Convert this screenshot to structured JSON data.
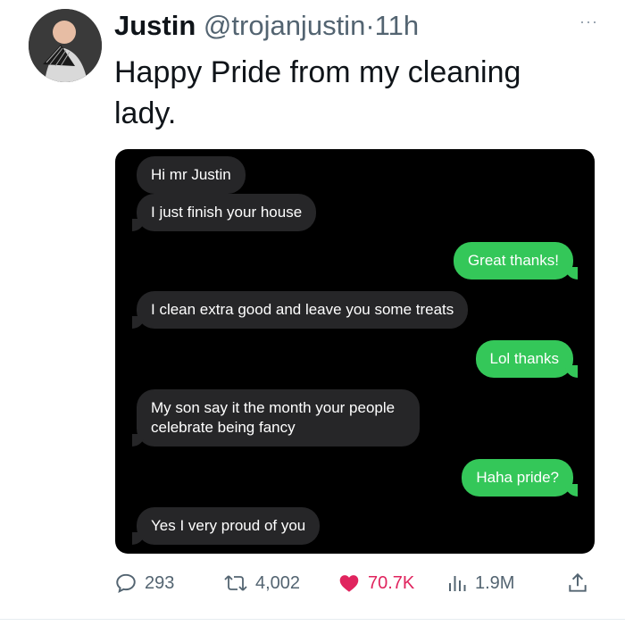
{
  "tweet": {
    "author_name": "Justin",
    "handle": "@trojanjustin",
    "separator": "·",
    "time": "11h",
    "more_label": "···",
    "text": "Happy Pride from my cleaning lady."
  },
  "messages": [
    {
      "side": "in",
      "text": "Hi mr Justin"
    },
    {
      "side": "in",
      "text": "I just finish your house"
    },
    {
      "side": "out",
      "text": "Great thanks!"
    },
    {
      "side": "in",
      "text": "I clean extra good and leave you some treats"
    },
    {
      "side": "out",
      "text": "Lol thanks"
    },
    {
      "side": "in",
      "text": "My son say it the month your people celebrate being fancy"
    },
    {
      "side": "out",
      "text": "Haha pride?"
    },
    {
      "side": "in",
      "text": "Yes I very proud of you"
    }
  ],
  "stats": {
    "replies": "293",
    "retweets": "4,002",
    "likes": "70.7K",
    "views": "1.9M"
  },
  "icons": {
    "reply": "reply-icon",
    "retweet": "retweet-icon",
    "like": "heart-icon",
    "views": "views-icon",
    "share": "share-icon"
  },
  "colors": {
    "incoming_bubble": "#262628",
    "outgoing_bubble": "#34c759",
    "like": "#e0245e",
    "muted": "#536471"
  }
}
